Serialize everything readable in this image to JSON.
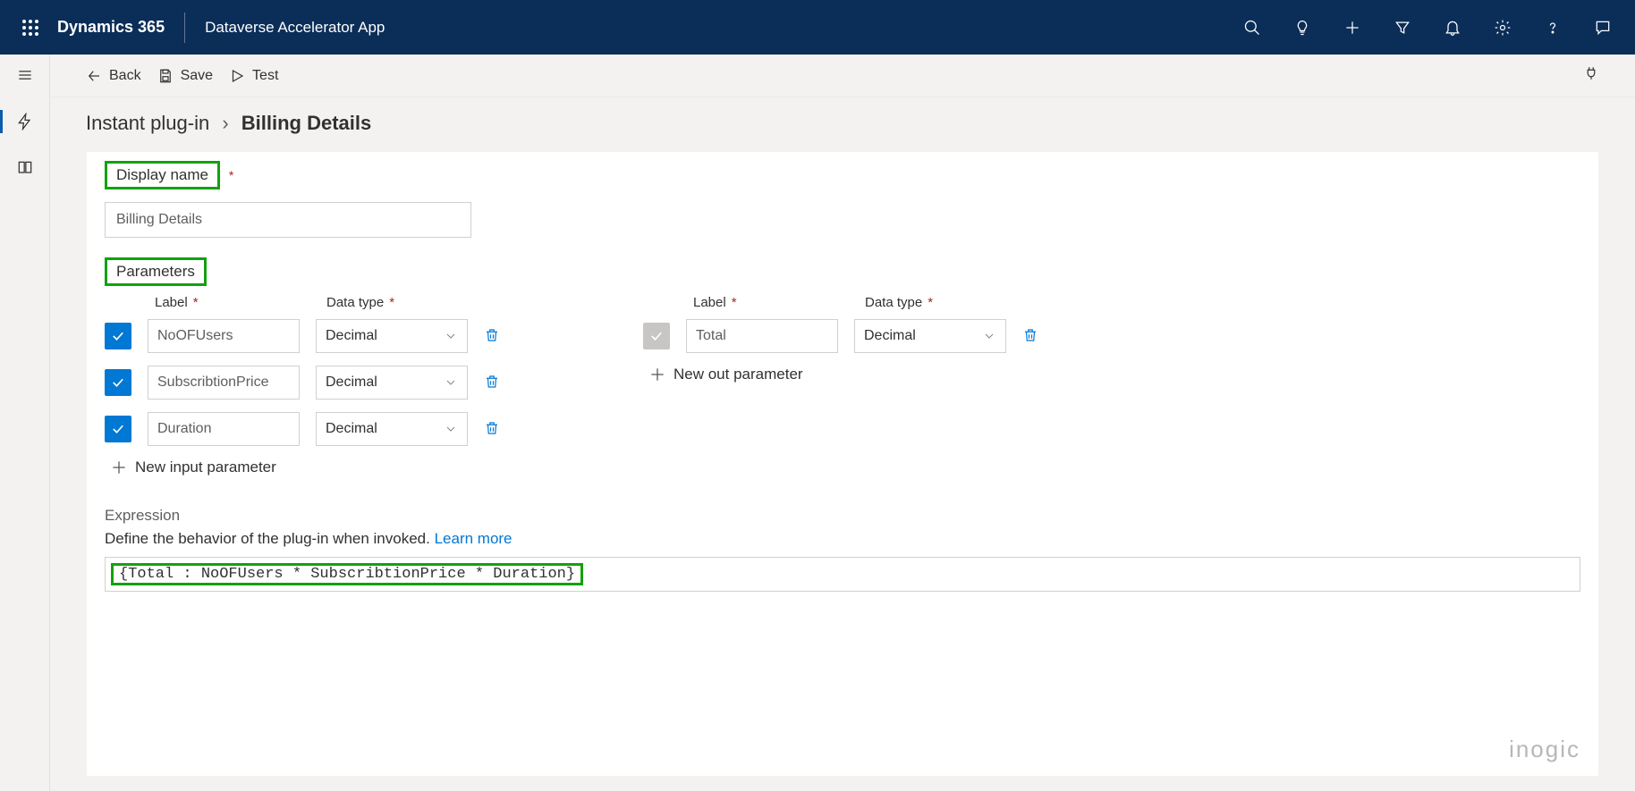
{
  "header": {
    "brand": "Dynamics 365",
    "app_name": "Dataverse Accelerator App"
  },
  "commands": {
    "back": "Back",
    "save": "Save",
    "test": "Test"
  },
  "breadcrumb": {
    "parent": "Instant plug-in",
    "current": "Billing Details"
  },
  "form": {
    "display_name_label": "Display name",
    "display_name_value": "Billing Details",
    "parameters_label": "Parameters",
    "col_label": "Label",
    "col_type": "Data type",
    "input_params": [
      {
        "label": "NoOFUsers",
        "type": "Decimal",
        "checked": true
      },
      {
        "label": "SubscribtionPrice",
        "type": "Decimal",
        "checked": true
      },
      {
        "label": "Duration",
        "type": "Decimal",
        "checked": true
      }
    ],
    "add_input_label": "New input parameter",
    "output_params": [
      {
        "label": "Total",
        "type": "Decimal",
        "checked": false
      }
    ],
    "add_output_label": "New out parameter",
    "expression_title": "Expression",
    "expression_sub": "Define the behavior of the plug-in when invoked. ",
    "learn_more": "Learn more",
    "expression_code": "{Total : NoOFUsers * SubscribtionPrice * Duration}"
  },
  "watermark": "inogic"
}
